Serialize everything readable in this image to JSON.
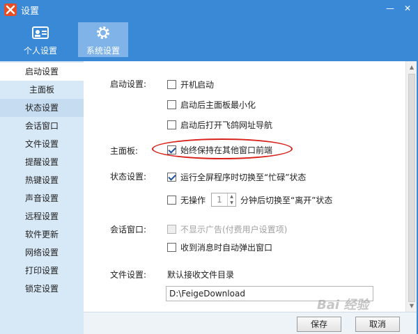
{
  "window": {
    "title": "设置",
    "minimize_glyph": "—",
    "close_glyph": "✕"
  },
  "tabs": [
    {
      "label": "个人设置",
      "icon": "person-card-icon"
    },
    {
      "label": "系统设置",
      "icon": "gear-icon",
      "selected": true
    }
  ],
  "sidebar": {
    "items": [
      {
        "label": "启动设置",
        "selected": true
      },
      {
        "label": "主面板"
      },
      {
        "label": "状态设置",
        "hover": true
      },
      {
        "label": "会话窗口"
      },
      {
        "label": "文件设置"
      },
      {
        "label": "提醒设置"
      },
      {
        "label": "热键设置"
      },
      {
        "label": "声音设置"
      },
      {
        "label": "远程设置"
      },
      {
        "label": "软件更新"
      },
      {
        "label": "网络设置"
      },
      {
        "label": "打印设置"
      },
      {
        "label": "锁定设置"
      }
    ]
  },
  "startup": {
    "label": "启动设置:",
    "options": [
      {
        "label": "开机启动",
        "checked": false
      },
      {
        "label": "启动后主面板最小化",
        "checked": false
      },
      {
        "label": "启动后打开飞鸽网址导航",
        "checked": false
      }
    ]
  },
  "main_panel": {
    "label": "主面板:",
    "option": {
      "label": "始终保持在其他窗口前端",
      "checked": true
    }
  },
  "status": {
    "label": "状态设置:",
    "busy_option": {
      "label": "运行全屏程序时切换至“忙碌”状态",
      "checked": true
    },
    "idle_option": {
      "label": "无操作",
      "checked": false
    },
    "idle_minutes": "1",
    "idle_after": "分钟后切换至“离开”状态"
  },
  "session": {
    "label": "会话窗口:",
    "options": [
      {
        "label": "不显示广告(付费用户设置项)",
        "checked": false,
        "disabled": true
      },
      {
        "label": "收到消息时自动弹出窗口",
        "checked": false
      }
    ]
  },
  "file": {
    "label": "文件设置:",
    "recv_dir_label": "默认接收文件目录",
    "recv_dir_value": "D:\\FeigeDownload"
  },
  "buttons": {
    "save": "保存",
    "cancel": "取消"
  },
  "watermark": "Bai 经验",
  "colors": {
    "titlebar": "#3a89d6",
    "selected_tab": "#80b3e8",
    "sidebar": "#d7e8f7",
    "highlight_ellipse": "#d9201a"
  }
}
